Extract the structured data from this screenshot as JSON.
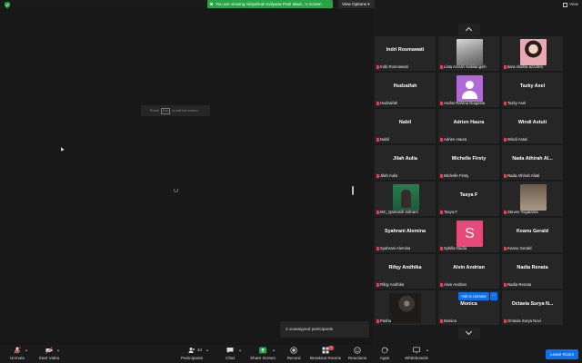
{
  "topbar": {
    "sharing_banner": "You are viewing Aiisyahrah Kalyana Putri Maul...'s screen",
    "view_options": "View Options",
    "view_label": "View"
  },
  "share": {
    "fullscreen_hint_prefix": "Press",
    "fullscreen_hint_key": "Esc",
    "fullscreen_hint_suffix": "to exit full screen",
    "breakout_notice": "3 unassigned participants"
  },
  "gallery": {
    "tiles": [
      {
        "big": "Indri Rosmawati",
        "label": "Indri Rosmawati",
        "photo": "none"
      },
      {
        "big": "",
        "label": "Lista Azizah Nabilangsih",
        "photo": "statue"
      },
      {
        "big": "",
        "label": "tiara shafira azzahra",
        "photo": "girl"
      },
      {
        "big": "Hudzaifah",
        "label": "Hudzaifah",
        "photo": "none"
      },
      {
        "big": "",
        "label": "Andini Rahma Diagosta",
        "photo": "avatar"
      },
      {
        "big": "Tazky Axel",
        "label": "Tazky Axel",
        "photo": "none"
      },
      {
        "big": "Nabil",
        "label": "Nabil",
        "photo": "none"
      },
      {
        "big": "Adrien Haura",
        "label": "Adrien Haura",
        "photo": "none"
      },
      {
        "big": "Windi Astuti",
        "label": "Windi Astuti",
        "photo": "none"
      },
      {
        "big": "Jilah Aulia",
        "label": "Jilah Aulia",
        "photo": "none"
      },
      {
        "big": "Michelle Firsty",
        "label": "Michelle Firsty",
        "photo": "none"
      },
      {
        "big": "Nada Athirah Al...",
        "label": "Nada Athirah Allati",
        "photo": "none"
      },
      {
        "big": "",
        "label": "MC_Qamasih Indriani",
        "photo": "green"
      },
      {
        "big": "Tasya F",
        "label": "Tasya F",
        "photo": "none"
      },
      {
        "big": "",
        "label": "Steven Yogatama",
        "photo": "kid"
      },
      {
        "big": "Syahrani Alemina",
        "label": "Syahrani Alemina",
        "photo": "none"
      },
      {
        "big": "",
        "label": "Sybilla Nadia",
        "photo": "s-avatar",
        "initial": "S"
      },
      {
        "big": "Keanu Gerald",
        "label": "Keanu Gerald",
        "photo": "none"
      },
      {
        "big": "Rifqy Andhika",
        "label": "Rifqy Andhika",
        "photo": "none"
      },
      {
        "big": "Alvin Andrian",
        "label": "Alvin Andrian",
        "photo": "none"
      },
      {
        "big": "Nadia Renata",
        "label": "Nadia Renata",
        "photo": "none"
      },
      {
        "big": "",
        "label": "Pasha",
        "photo": "dark"
      },
      {
        "big": "Monica",
        "label": "Monica",
        "photo": "none"
      },
      {
        "big": "Octavia Surya N...",
        "label": "Octavia Surya Novi",
        "photo": "none"
      }
    ],
    "ask_to_unmute": "Ask to Unmute",
    "more": "..."
  },
  "toolbar": {
    "unmute": "Unmute",
    "start_video": "Start Video",
    "participants": "Participants",
    "participants_count": "34",
    "chat": "Chat",
    "share_screen": "Share Screen",
    "record": "Record",
    "breakout_rooms": "Breakout Rooms",
    "reactions": "Reactions",
    "apps": "Apps",
    "whiteboards": "Whiteboards",
    "leave_room": "Leave Room"
  },
  "colors": {
    "accent": "#0e71eb",
    "share_green": "#27a348",
    "mute_red": "#e0444e",
    "tile_bg": "#262626"
  }
}
